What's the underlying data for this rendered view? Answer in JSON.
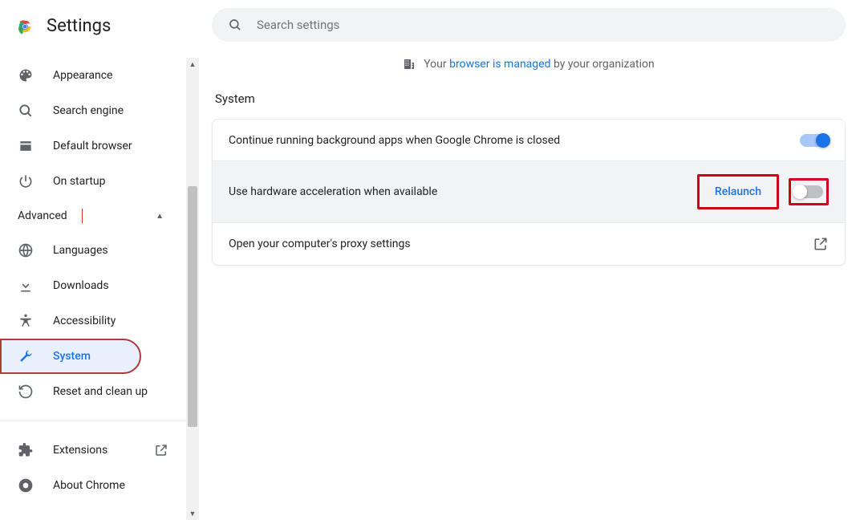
{
  "header": {
    "title": "Settings"
  },
  "search": {
    "placeholder": "Search settings"
  },
  "managed": {
    "prefix": "Your ",
    "link": "browser is managed",
    "suffix": " by your organization"
  },
  "sidebar": {
    "items": [
      {
        "label": "Appearance"
      },
      {
        "label": "Search engine"
      },
      {
        "label": "Default browser"
      },
      {
        "label": "On startup"
      }
    ],
    "advanced_label": "Advanced",
    "advanced_items": [
      {
        "label": "Languages"
      },
      {
        "label": "Downloads"
      },
      {
        "label": "Accessibility"
      },
      {
        "label": "System"
      },
      {
        "label": "Reset and clean up"
      }
    ],
    "footer": [
      {
        "label": "Extensions"
      },
      {
        "label": "About Chrome"
      }
    ]
  },
  "section": {
    "title": "System",
    "rows": {
      "bg_apps": {
        "label": "Continue running background apps when Google Chrome is closed",
        "on": true
      },
      "hw_accel": {
        "label": "Use hardware acceleration when available",
        "relaunch": "Relaunch",
        "on": false
      },
      "proxy": {
        "label": "Open your computer's proxy settings"
      }
    }
  }
}
